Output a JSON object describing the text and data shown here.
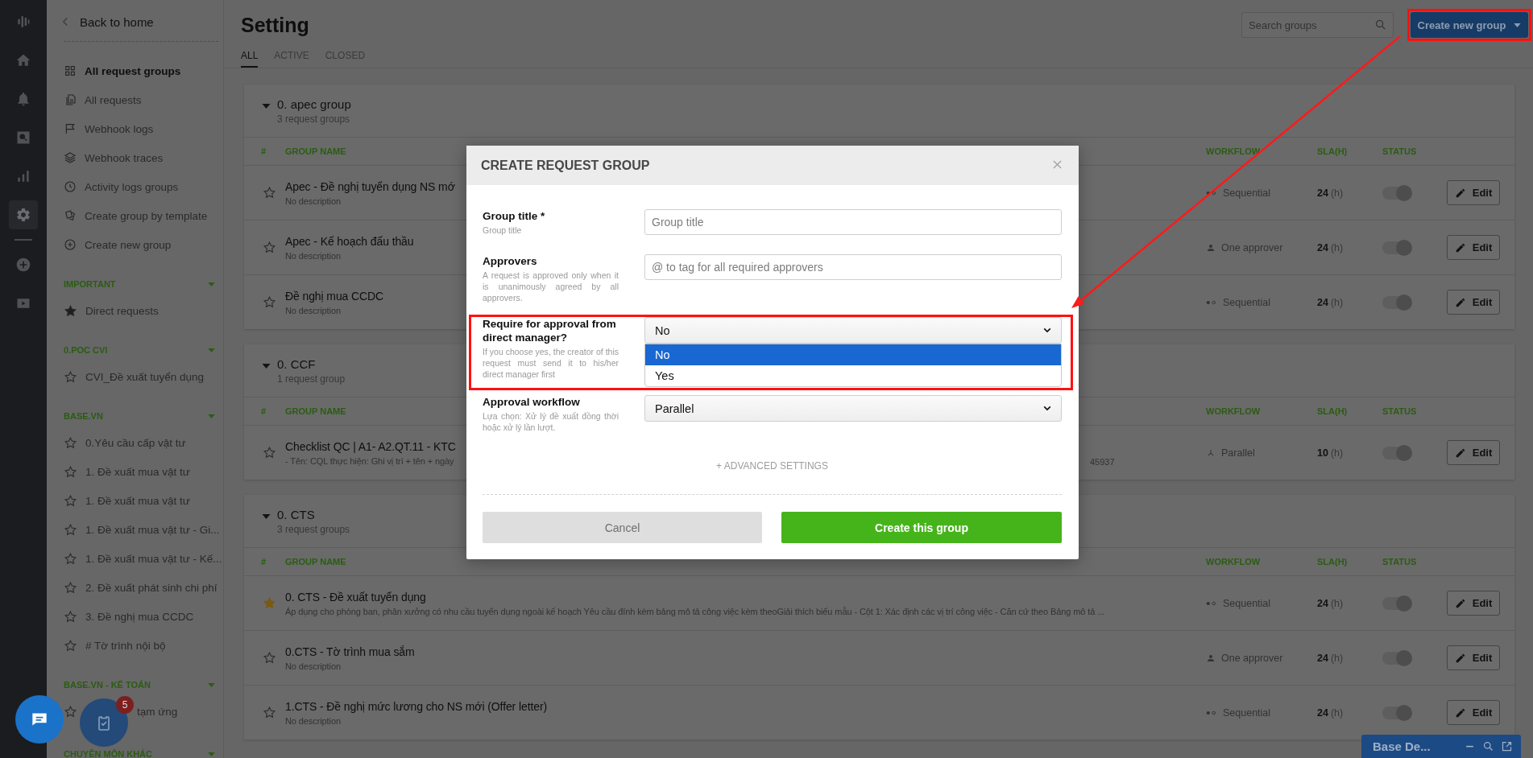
{
  "rail": {
    "top": [
      {
        "kind": "logo",
        "selected": false
      },
      {
        "kind": "home",
        "selected": false
      },
      {
        "kind": "bell",
        "selected": false
      },
      {
        "kind": "search",
        "selected": false
      },
      {
        "kind": "chart",
        "selected": false
      },
      {
        "kind": "gear",
        "selected": true
      }
    ],
    "bottom": [
      {
        "kind": "add",
        "selected": false
      },
      {
        "kind": "play",
        "selected": false
      }
    ]
  },
  "sidebar": {
    "back": "Back to home",
    "nav": [
      {
        "label": "All request groups",
        "selected": true
      },
      {
        "label": "All requests",
        "selected": false
      },
      {
        "label": "Webhook logs",
        "selected": false
      },
      {
        "label": "Webhook traces",
        "selected": false
      },
      {
        "label": "Activity logs groups",
        "selected": false
      },
      {
        "label": "Create group by template",
        "selected": false
      },
      {
        "label": "Create new group",
        "selected": false
      }
    ],
    "sections": [
      {
        "title": "IMPORTANT",
        "expanded": true,
        "items": [
          {
            "label": "Direct requests",
            "starred": true
          }
        ]
      },
      {
        "title": "0.POC CVI",
        "expanded": true,
        "items": [
          {
            "label": "CVI_Đề xuất tuyển dụng",
            "starred": false
          }
        ]
      },
      {
        "title": "BASE.VN",
        "expanded": true,
        "items": [
          {
            "label": "0.Yêu cầu cấp vật tư",
            "starred": false
          },
          {
            "label": "1. Đề xuất mua vật tư",
            "starred": false
          },
          {
            "label": "1. Đề xuất mua vật tư",
            "starred": false
          },
          {
            "label": "1. Đề xuất mua vật tư - Gi...",
            "starred": false
          },
          {
            "label": "1. Đề xuất mua vật tư - Kế...",
            "starred": false
          },
          {
            "label": "2. Đề xuất phát sinh chi phí",
            "starred": false
          },
          {
            "label": "3. Đề nghị mua CCDC",
            "starred": false
          },
          {
            "label": "# Tờ trình nội bộ",
            "starred": false
          }
        ]
      },
      {
        "title": "BASE.VN - KẾ TOÁN",
        "expanded": true,
        "items": [
          {
            "label": "tạm ứng",
            "starred": false,
            "covered": true
          }
        ]
      },
      {
        "title": "CHUYÊN MÔN KHÁC",
        "expanded": true
      }
    ]
  },
  "header": {
    "title": "Setting",
    "tabs": [
      {
        "label": "ALL",
        "selected": true
      },
      {
        "label": "ACTIVE",
        "selected": false
      },
      {
        "label": "CLOSED",
        "selected": false
      }
    ],
    "search": {
      "placeholder": "Search groups"
    },
    "create_button": "Create new group"
  },
  "groups": [
    {
      "name": "0. apec group",
      "count": "3 request groups",
      "expanded": true,
      "columns": [
        "#",
        "GROUP NAME",
        "WORKFLOW",
        "SLA(H)",
        "STATUS"
      ],
      "rows": [
        {
          "starred": false,
          "name": "Apec - Đề nghị tuyển dụng NS mớ",
          "description": "No description",
          "workflow": {
            "kind": "sequential",
            "label": "Sequential"
          },
          "sla": "24",
          "unit": "(h)",
          "on": true,
          "action": "Edit"
        },
        {
          "starred": false,
          "name": "Apec - Kế hoạch đấu thầu",
          "description": "No description",
          "workflow": {
            "kind": "one",
            "label": "One approver"
          },
          "sla": "24",
          "unit": "(h)",
          "on": true,
          "action": "Edit"
        },
        {
          "starred": false,
          "name": "Đề nghị mua CCDC",
          "description": "No description",
          "workflow": {
            "kind": "sequential",
            "label": "Sequential"
          },
          "sla": "24",
          "unit": "(h)",
          "on": true,
          "action": "Edit"
        }
      ]
    },
    {
      "name": "0. CCF",
      "count": "1 request group",
      "expanded": true,
      "columns": [
        "#",
        "GROUP NAME",
        "WORKFLOW",
        "SLA(H)",
        "STATUS"
      ],
      "rows": [
        {
          "starred": false,
          "name": "Checklist QC | A1- A2.QT.11 - KTC",
          "description": "- Tên: CQL thực hiện: Ghi vị trí + tên + ngày",
          "description_tail": "45937",
          "workflow": {
            "kind": "parallel",
            "label": "Parallel"
          },
          "sla": "10",
          "unit": "(h)",
          "on": true,
          "action": "Edit"
        }
      ]
    },
    {
      "name": "0. CTS",
      "count": "3 request groups",
      "expanded": true,
      "columns": [
        "#",
        "GROUP NAME",
        "WORKFLOW",
        "SLA(H)",
        "STATUS"
      ],
      "rows": [
        {
          "starred": true,
          "name": "0. CTS - Đề xuất tuyển dụng",
          "description": "Áp dụng cho phòng ban, phân xưởng có nhu cầu tuyển dụng ngoài kế hoạch Yêu cầu đính kèm bảng mô tả công việc kèm theoGiải thích biểu mẫu - Cột 1: Xác định các vị trí công việc - Căn cứ theo Bảng mô tả ...",
          "workflow": {
            "kind": "sequential",
            "label": "Sequential"
          },
          "sla": "24",
          "unit": "(h)",
          "on": true,
          "action": "Edit"
        },
        {
          "starred": false,
          "name": "0.CTS - Tờ trình mua sắm",
          "description": "No description",
          "workflow": {
            "kind": "one",
            "label": "One approver"
          },
          "sla": "24",
          "unit": "(h)",
          "on": true,
          "action": "Edit"
        },
        {
          "starred": false,
          "name": "1.CTS - Đề nghị mức lương cho NS mới (Offer letter)",
          "description": "No description",
          "workflow": {
            "kind": "sequential",
            "label": "Sequential"
          },
          "sla": "24",
          "unit": "(h)",
          "on": true,
          "action": "Edit"
        }
      ]
    }
  ],
  "modal": {
    "title": "CREATE REQUEST GROUP",
    "fields": [
      {
        "kind": "input",
        "label": "Group title *",
        "hint": "Group title",
        "placeholder": "Group title"
      },
      {
        "kind": "input",
        "label": "Approvers",
        "hint": "A request is approved only when it is unanimously agreed by all approvers.",
        "placeholder": "@ to tag for all required approvers"
      },
      {
        "kind": "select",
        "label": "Require for approval from direct manager?",
        "hint": "If you choose yes, the creator of this request must send it to his/her direct manager first",
        "value": "No",
        "expanded": true,
        "options": [
          {
            "label": "No",
            "selected": true
          },
          {
            "label": "Yes",
            "selected": false
          }
        ]
      },
      {
        "kind": "select",
        "label": "Approval workflow",
        "hint": "Lựa chọn: Xử lý đề xuất đồng thời hoặc xử lý lần lượt.",
        "value": "Parallel",
        "expanded": false
      }
    ],
    "advanced": "+ ADVANCED SETTINGS",
    "cancel": "Cancel",
    "submit": "Create this group"
  },
  "floating": {
    "badge": "5"
  },
  "chat_bar": {
    "title": "Base De..."
  }
}
